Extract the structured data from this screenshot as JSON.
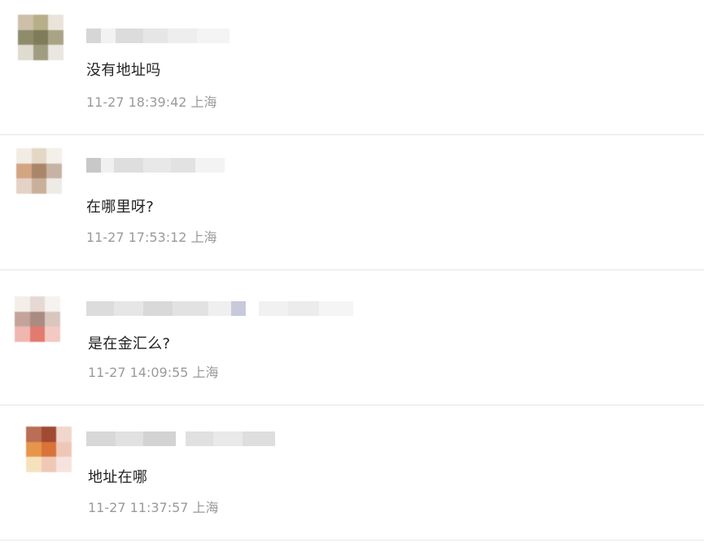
{
  "comments": [
    {
      "text": "没有地址吗",
      "time": "11-27 18:39:42",
      "location": "上海"
    },
    {
      "text": "在哪里呀?",
      "time": "11-27 17:53:12",
      "location": "上海"
    },
    {
      "text": "是在金汇么?",
      "time": "11-27 14:09:55",
      "location": "上海"
    },
    {
      "text": "地址在哪",
      "time": "11-27 11:37:57",
      "location": "上海"
    }
  ]
}
